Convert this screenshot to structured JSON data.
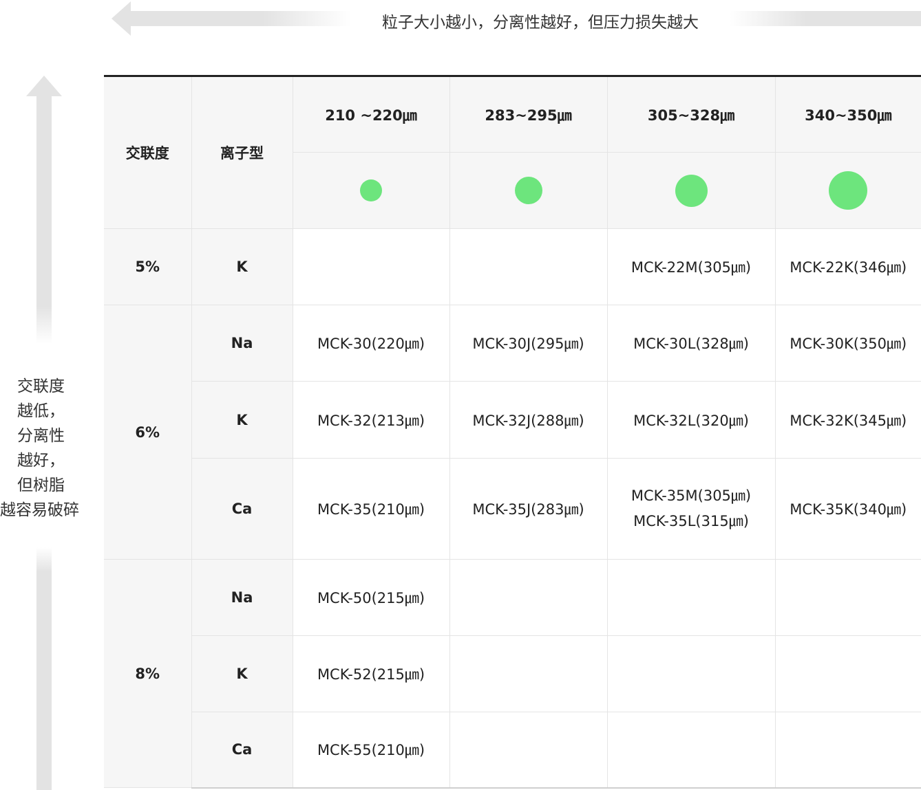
{
  "top_caption": "粒子大小越小，分离性越好，但压力损失越大",
  "side_caption": [
    "交联度",
    "越低，",
    "分离性",
    "越好，",
    "但树脂",
    "越容易破碎"
  ],
  "header": {
    "crosslink": "交联度",
    "ion_type": "离子型",
    "sizes": [
      "210 ~220㎛",
      "283~295㎛",
      "305~328㎛",
      "340~350㎛"
    ]
  },
  "dot_color": "#6de57d",
  "groups": [
    {
      "crosslink": "5%",
      "rows": [
        {
          "ion": "K",
          "cells": [
            "",
            "",
            "MCK-22M(305㎛)",
            "MCK-22K(346㎛)"
          ]
        }
      ]
    },
    {
      "crosslink": "6%",
      "rows": [
        {
          "ion": "Na",
          "cells": [
            "MCK-30(220㎛)",
            "MCK-30J(295㎛)",
            "MCK-30L(328㎛)",
            "MCK-30K(350㎛)"
          ]
        },
        {
          "ion": "K",
          "cells": [
            "MCK-32(213㎛)",
            "MCK-32J(288㎛)",
            "MCK-32L(320㎛)",
            "MCK-32K(345㎛)"
          ]
        },
        {
          "ion": "Ca",
          "cells": [
            "MCK-35(210㎛)",
            "MCK-35J(283㎛)",
            "MCK-35M(305㎛)",
            "MCK-35K(340㎛)"
          ],
          "extra_c3": "MCK-35L(315㎛)"
        }
      ]
    },
    {
      "crosslink": "8%",
      "rows": [
        {
          "ion": "Na",
          "cells": [
            "MCK-50(215㎛)",
            "",
            "",
            ""
          ]
        },
        {
          "ion": "K",
          "cells": [
            "MCK-52(215㎛)",
            "",
            "",
            ""
          ]
        },
        {
          "ion": "Ca",
          "cells": [
            "MCK-55(210㎛)",
            "",
            "",
            ""
          ]
        }
      ]
    }
  ]
}
